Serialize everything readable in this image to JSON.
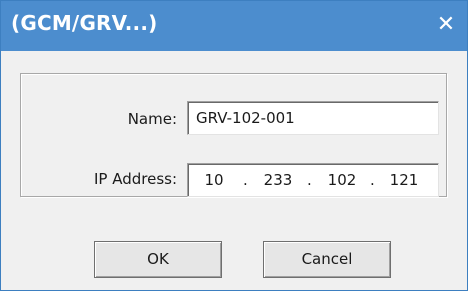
{
  "window": {
    "title": "(GCM/GRV...)",
    "close_symbol": "✕",
    "close_icon": "close-icon",
    "titlebar_color": "#4c8dce"
  },
  "form": {
    "name_label": "Name:",
    "name_value": "GRV-102-001",
    "ip_label": "IP Address:",
    "ip_octets": [
      "10",
      "233",
      "102",
      "121"
    ],
    "ip_separator": "."
  },
  "buttons": {
    "ok_label": "OK",
    "cancel_label": "Cancel"
  }
}
